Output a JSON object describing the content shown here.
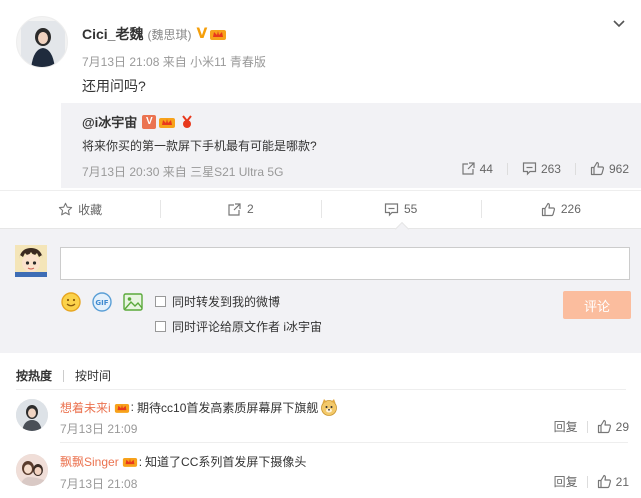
{
  "post": {
    "author_name": "Cici_老魏",
    "author_remark": "(魏思琪)",
    "verified_mark": "V",
    "time": "7月13日 21:08",
    "source": "来自 小米11 青春版",
    "content": "还用问吗?"
  },
  "repost": {
    "author": "@i冰宇宙",
    "verified_mark": "V",
    "content": "将来你买的第一款屏下手机最有可能是哪款?",
    "time": "7月13日 20:30",
    "source": "来自 三星S21 Ultra 5G",
    "reposts": "44",
    "comments": "263",
    "likes": "962"
  },
  "actions": {
    "favorite_label": "收藏",
    "repost_count": "2",
    "comment_count": "55",
    "like_count": "226"
  },
  "composer": {
    "input_value": "",
    "option_forward": "同时转发到我的微博",
    "option_comment_original": "同时评论给原文作者 i冰宇宙",
    "submit_label": "评论"
  },
  "sort": {
    "hot_label": "按热度",
    "time_label": "按时间"
  },
  "comments": [
    {
      "user": "想着未来i",
      "separator": ":",
      "text": "期待cc10首发高素质屏幕屏下旗舰",
      "time": "7月13日 21:09",
      "reply_label": "回复",
      "likes": "29"
    },
    {
      "user": "飘飘Singer",
      "separator": ":",
      "text": "知道了CC系列首发屏下摄像头",
      "time": "7月13日 21:08",
      "reply_label": "回复",
      "likes": "21"
    }
  ],
  "colors": {
    "accent": "#eb7350",
    "submit_disabled": "#fbbd9e",
    "repost_bg": "#f2f2f5",
    "gold_v": "#f59f0b"
  },
  "icons": {
    "chevron": "chevron-down-icon",
    "favorite": "star-icon",
    "repost": "repost-icon",
    "comment": "comment-icon",
    "like": "thumbs-up-icon",
    "emoji": "emoji-icon",
    "gif": "gif-icon",
    "image": "image-icon"
  }
}
